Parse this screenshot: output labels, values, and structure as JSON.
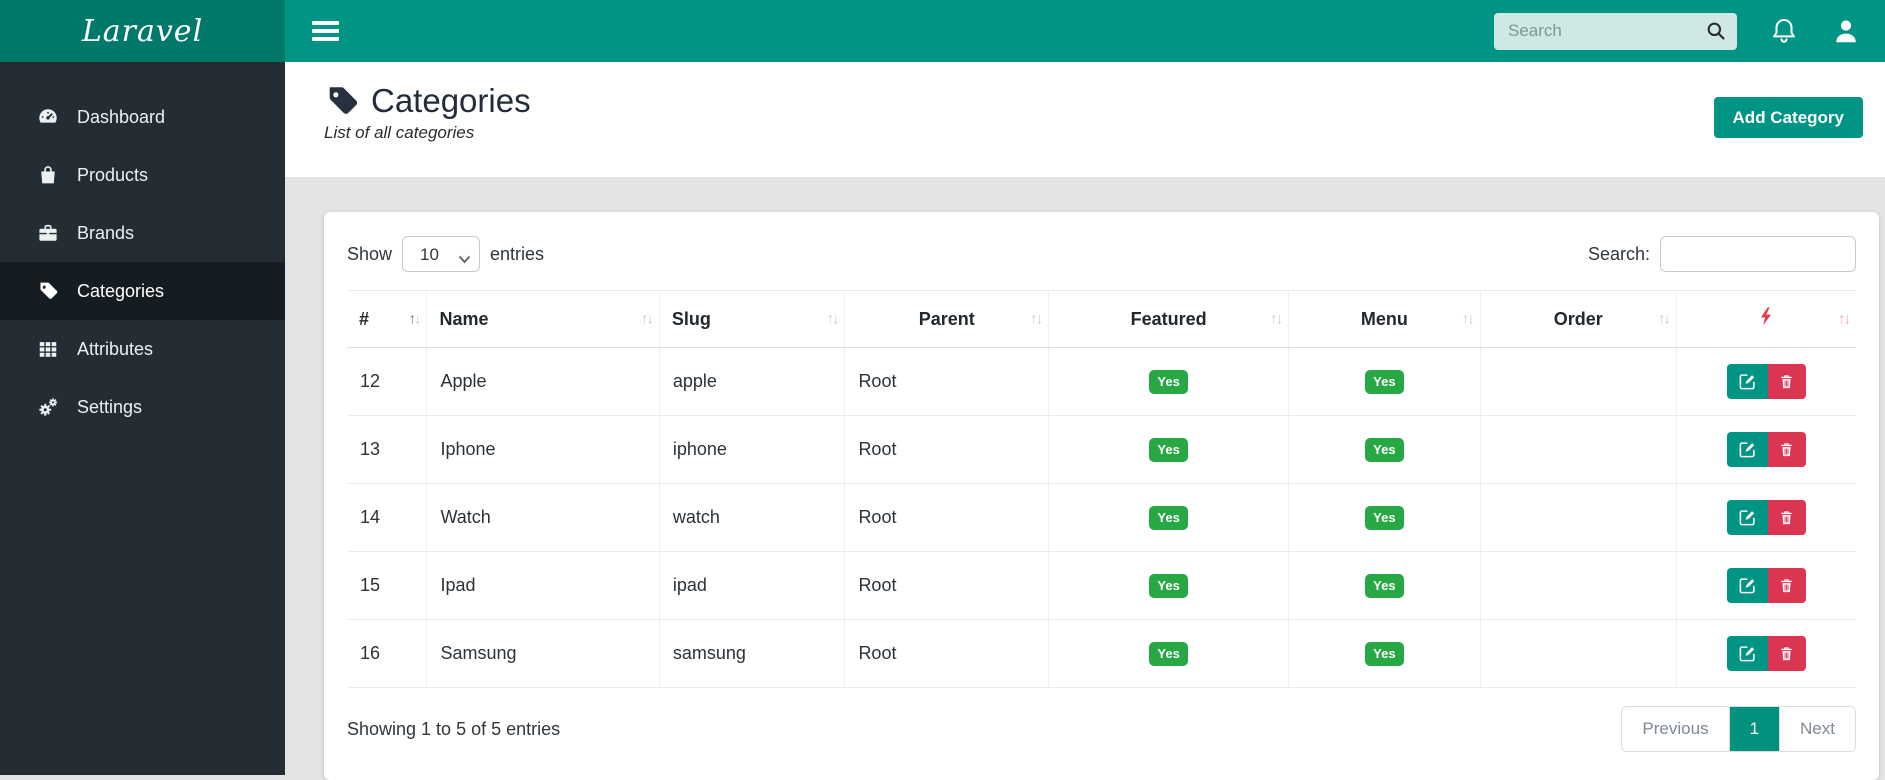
{
  "brand": {
    "logo_text": "Laravel"
  },
  "topbar": {
    "search_placeholder": "Search",
    "search_value": "",
    "icons": [
      "menu-icon",
      "magnifier-icon",
      "bell-icon",
      "user-icon"
    ]
  },
  "sidebar": {
    "items": [
      {
        "label": "Dashboard",
        "icon": "dashboard-icon",
        "active": false
      },
      {
        "label": "Products",
        "icon": "shopping-bag-icon",
        "active": false
      },
      {
        "label": "Brands",
        "icon": "briefcase-icon",
        "active": false
      },
      {
        "label": "Categories",
        "icon": "tag-icon",
        "active": true
      },
      {
        "label": "Attributes",
        "icon": "grid-icon",
        "active": false
      },
      {
        "label": "Settings",
        "icon": "cogs-icon",
        "active": false
      }
    ]
  },
  "page": {
    "title": "Categories",
    "title_icon": "tag-icon",
    "subtitle": "List of all categories",
    "add_button_label": "Add Category"
  },
  "table_controls": {
    "show_label": "Show",
    "entries_label": "entries",
    "page_size": "10",
    "page_size_options": [
      "10"
    ],
    "search_label": "Search:",
    "search_value": ""
  },
  "table": {
    "columns": [
      {
        "label": "#",
        "align": "left",
        "sort": "asc"
      },
      {
        "label": "Name",
        "align": "left",
        "sort": "both"
      },
      {
        "label": "Slug",
        "align": "left",
        "sort": "both"
      },
      {
        "label": "Parent",
        "align": "center",
        "sort": "both"
      },
      {
        "label": "Featured",
        "align": "center",
        "sort": "both"
      },
      {
        "label": "Menu",
        "align": "center",
        "sort": "both"
      },
      {
        "label": "Order",
        "align": "center",
        "sort": "both"
      },
      {
        "label": "",
        "align": "center",
        "sort": "both-red",
        "icon": "lightning-icon"
      }
    ],
    "rows": [
      {
        "id": "12",
        "name": "Apple",
        "slug": "apple",
        "parent": "Root",
        "featured": "Yes",
        "menu": "Yes",
        "order": ""
      },
      {
        "id": "13",
        "name": "Iphone",
        "slug": "iphone",
        "parent": "Root",
        "featured": "Yes",
        "menu": "Yes",
        "order": ""
      },
      {
        "id": "14",
        "name": "Watch",
        "slug": "watch",
        "parent": "Root",
        "featured": "Yes",
        "menu": "Yes",
        "order": ""
      },
      {
        "id": "15",
        "name": "Ipad",
        "slug": "ipad",
        "parent": "Root",
        "featured": "Yes",
        "menu": "Yes",
        "order": ""
      },
      {
        "id": "16",
        "name": "Samsung",
        "slug": "samsung",
        "parent": "Root",
        "featured": "Yes",
        "menu": "Yes",
        "order": ""
      }
    ],
    "row_action_icons": [
      "edit-icon",
      "trash-icon"
    ]
  },
  "footer": {
    "info": "Showing 1 to 5 of 5 entries",
    "pagination": {
      "previous": "Previous",
      "current": "1",
      "next": "Next"
    }
  },
  "colors": {
    "topbar_teal": "#009485",
    "logo_teal": "#00796b",
    "sidebar_dark": "#232d33",
    "sidebar_active": "#161d22",
    "page_gray": "#e4e4e4",
    "badge_green": "#28a745",
    "delete_red": "#dc3552",
    "lightning_red": "#e3394e"
  }
}
